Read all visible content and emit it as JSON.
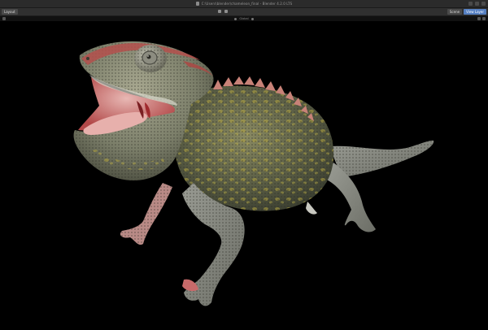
{
  "window": {
    "title": "C:\\Users\\blender\\chameleon_final - Blender 4.2.0 LTS"
  },
  "toolbar": {
    "workspace_label": "Layout",
    "right_buttons": [
      "Scene",
      "View Layer"
    ]
  },
  "viewport_header": {
    "view_label": "Global"
  },
  "colors": {
    "titlebar": "#2b2b2b",
    "toolbar": "#303030",
    "viewport_background": "#000000",
    "accent": "#5680c2"
  },
  "icons": {
    "file": "blender-file-icon",
    "transform": "transform-icon",
    "snap": "snap-icon",
    "overlay": "overlay-icon",
    "shading": "shading-icon"
  },
  "viewport": {
    "subject": "chameleon-3d-model"
  }
}
